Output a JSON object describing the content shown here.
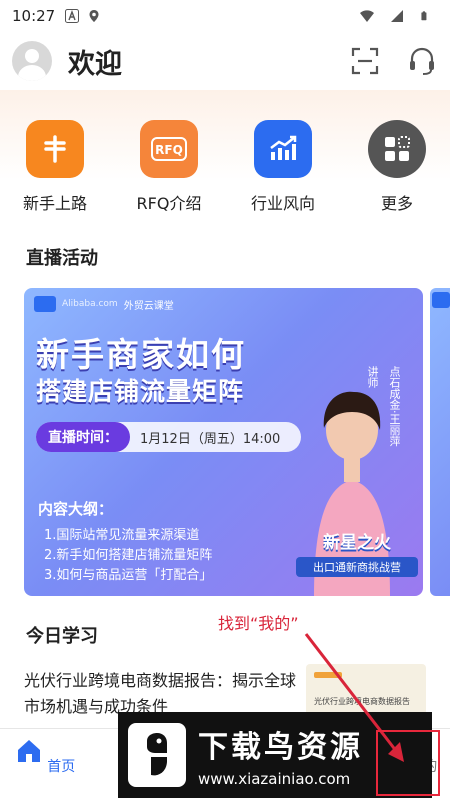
{
  "status_bar": {
    "time": "10:27"
  },
  "header": {
    "title": "欢迎"
  },
  "quick_entries": [
    {
      "label": "新手上路",
      "icon": "yen-icon",
      "color": "#f7871f"
    },
    {
      "label": "RFQ介绍",
      "icon": "rfq-icon",
      "color": "#f5853a"
    },
    {
      "label": "行业风向",
      "icon": "trend-chart-icon",
      "color": "#2c6cf0"
    },
    {
      "label": "更多",
      "icon": "more-grid-icon",
      "color": "#555555"
    }
  ],
  "live_section": {
    "title": "直播活动"
  },
  "banner": {
    "brand": "Alibaba.com",
    "sub_brand": "外贸云课堂",
    "title_line1": "新手商家如何",
    "title_line2": "搭建店铺流量矩阵",
    "time_label": "直播时间：",
    "time_value": "1月12日（周五）14:00",
    "outline_title": "内容大纲：",
    "outline_items": [
      "1.国际站常见流量来源渠道",
      "2.新手如何搭建店铺流量矩阵",
      "3.如何与商品运营「打配合」"
    ],
    "lecturer_label": "讲师",
    "lecturer_name": "点石成金·王丽萍",
    "badge_line1": "新星之火",
    "badge_line2": "出口通新商挑战营"
  },
  "study_section": {
    "title": "今日学习",
    "item_title": "光伏行业跨境电商数据报告：揭示全球市场机遇与成功条件",
    "thumb_text": "光伏行业跨境电商数据报告"
  },
  "annotation": {
    "text": "找到“我的”"
  },
  "bottom_nav": [
    {
      "label": "首页",
      "icon": "home-icon",
      "active": true
    },
    {
      "label": "",
      "icon": "course-icon",
      "active": false
    },
    {
      "label": "",
      "icon": "live-icon",
      "active": false
    },
    {
      "label": "",
      "icon": "community-icon",
      "active": false
    },
    {
      "label": "我的",
      "icon": "profile-icon",
      "active": false
    }
  ],
  "watermark": {
    "title": "下载鸟资源",
    "url": "www.xiazainiao.com"
  },
  "colors": {
    "accent": "#2d6cf0",
    "annotation": "#d9253a"
  }
}
